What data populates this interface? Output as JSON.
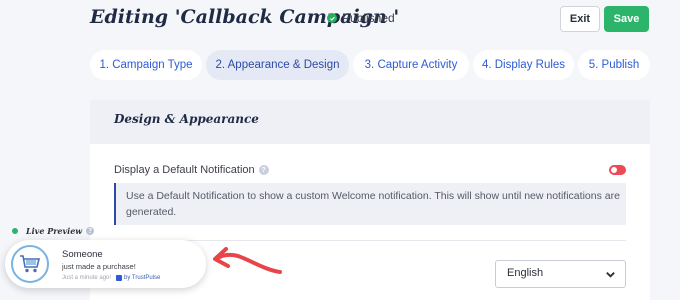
{
  "header": {
    "title": "Editing 'Callback Campaign '",
    "status": "Published",
    "exit_label": "Exit",
    "save_label": "Save"
  },
  "tabs": [
    {
      "label": "1. Campaign Type",
      "active": false
    },
    {
      "label": "2. Appearance & Design",
      "active": true
    },
    {
      "label": "3. Capture Activity",
      "active": false
    },
    {
      "label": "4. Display Rules",
      "active": false
    },
    {
      "label": "5. Publish",
      "active": false
    }
  ],
  "panel": {
    "title": "Design & Appearance",
    "setting_label": "Display a Default Notification",
    "setting_help_icon": "help-icon",
    "toggle_enabled": false,
    "note": "Use a Default Notification to show a custom Welcome notification. This will show until new notifications are generated.",
    "language_value": "English"
  },
  "preview": {
    "label": "Live Preview",
    "notification": {
      "name": "Someone",
      "action": "just made a purchase!",
      "time": "Just a minute ago!",
      "by": "by TrustPulse",
      "icon": "shopping-cart-icon"
    }
  },
  "colors": {
    "accent": "#2d5bd6",
    "save": "#2bb46a",
    "toggle_off": "#ec4a56",
    "arrow": "#e8454a"
  }
}
